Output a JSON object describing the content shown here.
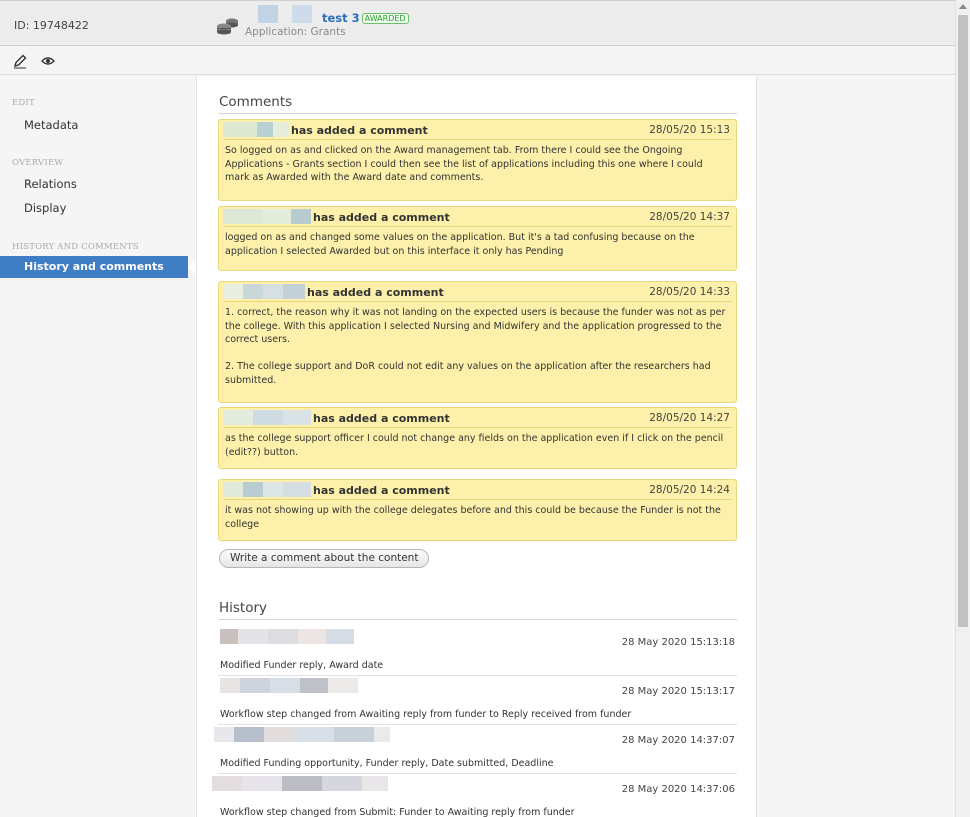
{
  "header": {
    "object_id": "ID: 19748422",
    "title": "test 3",
    "status_badge": "AWARDED",
    "subtitle": "Application: Grants"
  },
  "toolbar": {
    "edit_icon": "pencil-icon",
    "view_icon": "eye-icon"
  },
  "sidebar": {
    "sections": [
      {
        "label": "EDIT",
        "items": [
          "Metadata"
        ]
      },
      {
        "label": "OVERVIEW",
        "items": [
          "Relations",
          "Display"
        ]
      },
      {
        "label": "HISTORY AND COMMENTS",
        "items": [
          "History and comments"
        ]
      }
    ],
    "active_item": "History and comments",
    "accent_color": "#3f7dc4"
  },
  "comments": {
    "heading": "Comments",
    "items": [
      {
        "action": "has added a comment",
        "date": "28/05/20 15:13",
        "text": "So logged on as                    and clicked on the Award management tab. From there I could see the Ongoing Applications - Grants section I could then see the list of applications including this one where I could mark as Awarded with the Award date and comments."
      },
      {
        "action": "has added a comment",
        "date": "28/05/20 14:37",
        "text": "logged on as                          and changed some values on the application. But it's a tad confusing because on the application I selected Awarded but on this interface it only has Pending"
      },
      {
        "action": "has added a comment",
        "date": "28/05/20 14:33",
        "text": "1. correct, the reason why it was not landing on the expected users is because the funder was not as per the college. With this application I selected Nursing and Midwifery and the application progressed to the correct users.\n\n2. The college support and DoR could not edit any values on the application after the researchers had submitted."
      },
      {
        "action": "has added a comment",
        "date": "28/05/20 14:27",
        "text": "as the college support officer I could not change any fields on the application even if I click on the pencil (edit??) button."
      },
      {
        "action": "has added a comment",
        "date": "28/05/20 14:24",
        "text": "it was not showing up with the college delegates before and this could be because the Funder is not the college"
      }
    ],
    "write_button": "Write a comment about the content",
    "comment_bg_color": "#fcf0aa"
  },
  "history": {
    "heading": "History",
    "items": [
      {
        "date": "28 May 2020 15:13:18",
        "text": "Modified Funder reply, Award date"
      },
      {
        "date": "28 May 2020 15:13:17",
        "text": "Workflow step changed from Awaiting reply from funder to Reply received from funder"
      },
      {
        "date": "28 May 2020 14:37:07",
        "text": "Modified Funding opportunity, Funder reply, Date submitted, Deadline"
      },
      {
        "date": "28 May 2020 14:37:06",
        "text": "Workflow step changed from Submit: Funder to Awaiting reply from funder"
      }
    ]
  }
}
